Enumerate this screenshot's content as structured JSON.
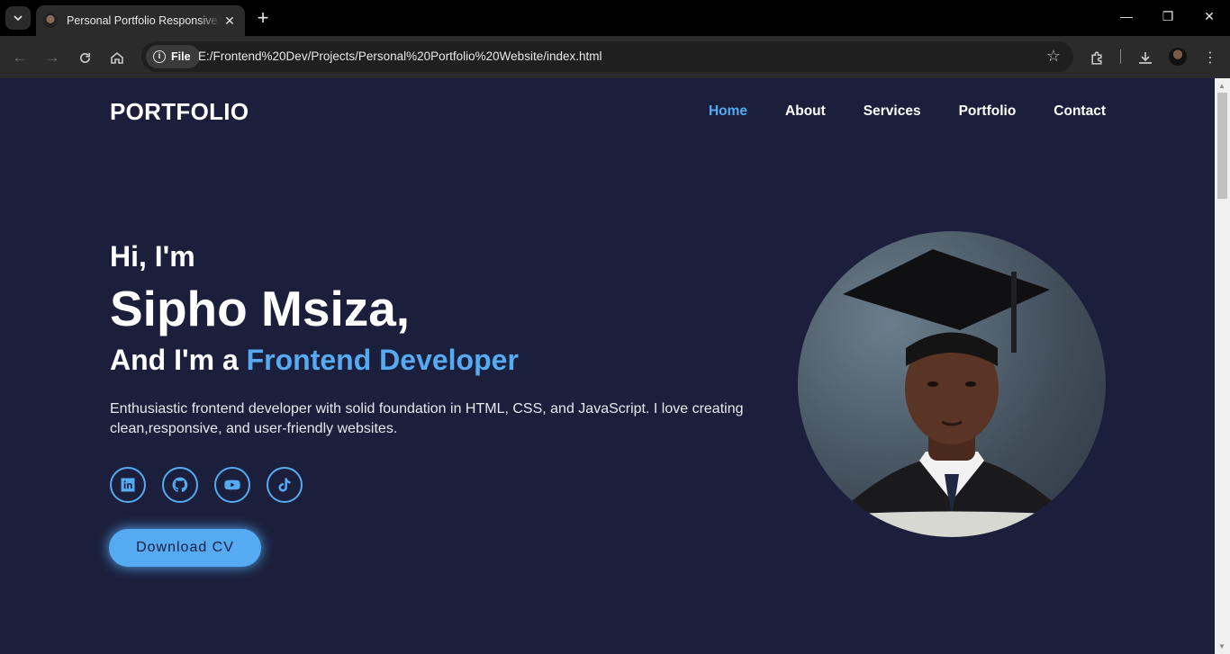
{
  "browser": {
    "tab_title": "Personal Portfolio Responsive Website",
    "tab_close": "✕",
    "new_tab": "+",
    "url_chip": "File",
    "url": "E:/Frontend%20Dev/Projects/Personal%20Portfolio%20Website/index.html",
    "controls": {
      "minimize": "—",
      "restore": "❐",
      "close": "✕"
    }
  },
  "site": {
    "logo": "PORTFOLIO",
    "nav": [
      {
        "label": "Home",
        "active": true
      },
      {
        "label": "About",
        "active": false
      },
      {
        "label": "Services",
        "active": false
      },
      {
        "label": "Portfolio",
        "active": false
      },
      {
        "label": "Contact",
        "active": false
      }
    ],
    "hero": {
      "greeting": "Hi, I'm",
      "name": "Sipho Msiza,",
      "role_prefix": "And I'm a ",
      "role": "Frontend Developer",
      "description": "Enthusiastic frontend developer with solid foundation in HTML, CSS, and JavaScript. I love creating clean,responsive, and user-friendly websites.",
      "socials": [
        "linkedin-icon",
        "github-icon",
        "youtube-icon",
        "tiktok-icon"
      ],
      "cta": "Download CV"
    },
    "colors": {
      "background": "#1b1f3b",
      "accent": "#55aaf2",
      "text": "#ffffff"
    }
  }
}
